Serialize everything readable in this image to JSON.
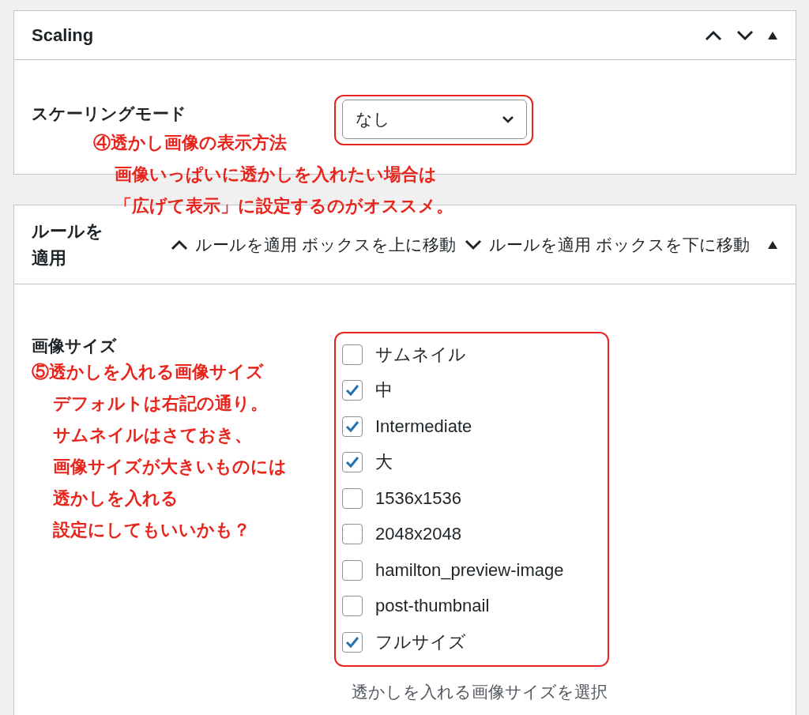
{
  "scaling": {
    "title": "Scaling",
    "label": "スケーリングモード",
    "select": {
      "value": "なし"
    }
  },
  "annotation_4": {
    "heading": "④透かし画像の表示方法",
    "lines": [
      "画像いっぱいに透かしを入れたい場合は",
      "「広げて表示」に設定するのがオススメ。"
    ]
  },
  "rules": {
    "title": "ルールを適用",
    "move_up": "ルールを適用 ボックスを上に移動",
    "move_down": "ルールを適用 ボックスを下に移動",
    "label": "画像サイズ",
    "options": [
      {
        "label": "サムネイル",
        "checked": false
      },
      {
        "label": "中",
        "checked": true
      },
      {
        "label": "Intermediate",
        "checked": true
      },
      {
        "label": "大",
        "checked": true
      },
      {
        "label": "1536x1536",
        "checked": false
      },
      {
        "label": "2048x2048",
        "checked": false
      },
      {
        "label": "hamilton_preview-image",
        "checked": false
      },
      {
        "label": "post-thumbnail",
        "checked": false
      },
      {
        "label": "フルサイズ",
        "checked": true
      }
    ],
    "help": "透かしを入れる画像サイズを選択"
  },
  "annotation_5": {
    "heading": "⑤透かしを入れる画像サイズ",
    "lines": [
      "デフォルトは右記の通り。",
      "サムネイルはさておき、",
      "画像サイズが大きいものには",
      "透かしを入れる",
      "設定にしてもいいかも？"
    ]
  }
}
